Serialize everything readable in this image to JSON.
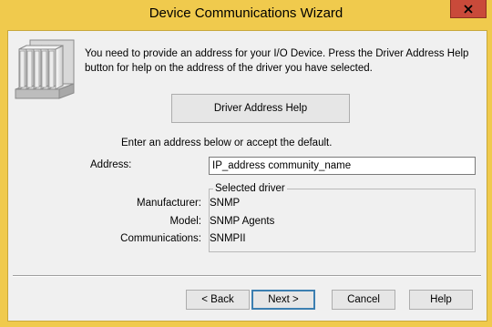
{
  "window": {
    "title": "Device Communications Wizard",
    "close_glyph": "✕"
  },
  "intro": {
    "text": "You need to provide an address for your I/O Device. Press the Driver Address Help button for help on the address of the driver you have selected."
  },
  "driver_help_button": {
    "label": "Driver Address Help"
  },
  "prompt": {
    "text": "Enter an address below or accept the default."
  },
  "address": {
    "label": "Address:",
    "value": "IP_address community_name"
  },
  "selected_driver": {
    "legend": "Selected driver",
    "manufacturer_label": "Manufacturer:",
    "manufacturer_value": "SNMP",
    "model_label": "Model:",
    "model_value": "SNMP Agents",
    "communications_label": "Communications:",
    "communications_value": "SNMPII"
  },
  "buttons": {
    "back": "< Back",
    "next": "Next >",
    "cancel": "Cancel",
    "help": "Help"
  },
  "icons": {
    "device": "io-device-rack-icon",
    "close": "close-icon"
  },
  "colors": {
    "titlebar": "#f0ca4d",
    "close_button": "#c94a3a",
    "client_bg": "#f0f0f0",
    "default_button_border": "#3c7fb1"
  }
}
